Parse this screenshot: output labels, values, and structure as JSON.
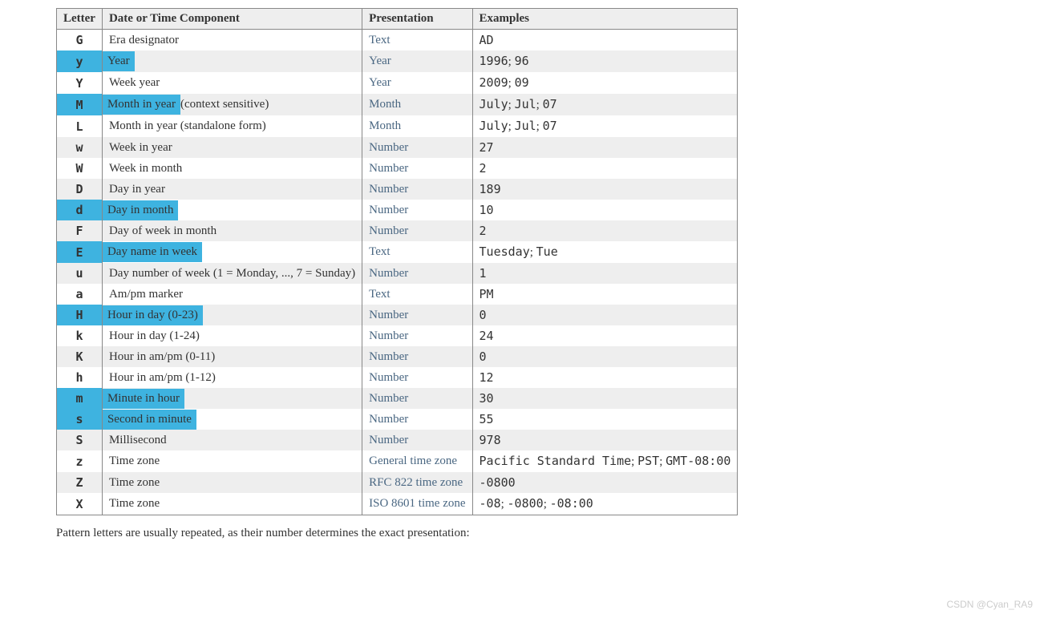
{
  "headers": [
    "Letter",
    "Date or Time Component",
    "Presentation",
    "Examples"
  ],
  "rows": [
    {
      "letter": "G",
      "desc_hl": "",
      "desc_rest": "Era designator",
      "presentation": "Text",
      "examples": [
        {
          "t": "code",
          "v": "AD"
        }
      ],
      "highlight": false
    },
    {
      "letter": "y",
      "desc_hl": "Year",
      "desc_rest": "",
      "presentation": "Year",
      "examples": [
        {
          "t": "code",
          "v": "1996"
        },
        {
          "t": "plain",
          "v": "; "
        },
        {
          "t": "code",
          "v": "96"
        }
      ],
      "highlight": true
    },
    {
      "letter": "Y",
      "desc_hl": "",
      "desc_rest": "Week year",
      "presentation": "Year",
      "examples": [
        {
          "t": "code",
          "v": "2009"
        },
        {
          "t": "plain",
          "v": "; "
        },
        {
          "t": "code",
          "v": "09"
        }
      ],
      "highlight": false
    },
    {
      "letter": "M",
      "desc_hl": "Month in year ",
      "desc_rest": "(context sensitive)",
      "presentation": "Month",
      "examples": [
        {
          "t": "code",
          "v": "July"
        },
        {
          "t": "plain",
          "v": "; "
        },
        {
          "t": "code",
          "v": "Jul"
        },
        {
          "t": "plain",
          "v": "; "
        },
        {
          "t": "code",
          "v": "07"
        }
      ],
      "highlight": true
    },
    {
      "letter": "L",
      "desc_hl": "",
      "desc_rest": "Month in year (standalone form)",
      "presentation": "Month",
      "examples": [
        {
          "t": "code",
          "v": "July"
        },
        {
          "t": "plain",
          "v": "; "
        },
        {
          "t": "code",
          "v": "Jul"
        },
        {
          "t": "plain",
          "v": "; "
        },
        {
          "t": "code",
          "v": "07"
        }
      ],
      "highlight": false
    },
    {
      "letter": "w",
      "desc_hl": "",
      "desc_rest": "Week in year",
      "presentation": "Number",
      "examples": [
        {
          "t": "code",
          "v": "27"
        }
      ],
      "highlight": false
    },
    {
      "letter": "W",
      "desc_hl": "",
      "desc_rest": "Week in month",
      "presentation": "Number",
      "examples": [
        {
          "t": "code",
          "v": "2"
        }
      ],
      "highlight": false
    },
    {
      "letter": "D",
      "desc_hl": "",
      "desc_rest": "Day in year",
      "presentation": "Number",
      "examples": [
        {
          "t": "code",
          "v": "189"
        }
      ],
      "highlight": false
    },
    {
      "letter": "d",
      "desc_hl": "Day in month",
      "desc_rest": "",
      "presentation": "Number",
      "examples": [
        {
          "t": "code",
          "v": "10"
        }
      ],
      "highlight": true
    },
    {
      "letter": "F",
      "desc_hl": "",
      "desc_rest": "Day of week in month",
      "presentation": "Number",
      "examples": [
        {
          "t": "code",
          "v": "2"
        }
      ],
      "highlight": false
    },
    {
      "letter": "E",
      "desc_hl": "Day name in week",
      "desc_rest": "",
      "presentation": "Text",
      "examples": [
        {
          "t": "code",
          "v": "Tuesday"
        },
        {
          "t": "plain",
          "v": "; "
        },
        {
          "t": "code",
          "v": "Tue"
        }
      ],
      "highlight": true
    },
    {
      "letter": "u",
      "desc_hl": "",
      "desc_rest": "Day number of week (1 = Monday, ..., 7 = Sunday)",
      "presentation": "Number",
      "examples": [
        {
          "t": "code",
          "v": "1"
        }
      ],
      "highlight": false
    },
    {
      "letter": "a",
      "desc_hl": "",
      "desc_rest": "Am/pm marker",
      "presentation": "Text",
      "examples": [
        {
          "t": "code",
          "v": "PM"
        }
      ],
      "highlight": false
    },
    {
      "letter": "H",
      "desc_hl": "Hour in day (0-23)",
      "desc_rest": "",
      "presentation": "Number",
      "examples": [
        {
          "t": "code",
          "v": "0"
        }
      ],
      "highlight": true
    },
    {
      "letter": "k",
      "desc_hl": "",
      "desc_rest": "Hour in day (1-24)",
      "presentation": "Number",
      "examples": [
        {
          "t": "code",
          "v": "24"
        }
      ],
      "highlight": false
    },
    {
      "letter": "K",
      "desc_hl": "",
      "desc_rest": "Hour in am/pm (0-11)",
      "presentation": "Number",
      "examples": [
        {
          "t": "code",
          "v": "0"
        }
      ],
      "highlight": false
    },
    {
      "letter": "h",
      "desc_hl": "",
      "desc_rest": "Hour in am/pm (1-12)",
      "presentation": "Number",
      "examples": [
        {
          "t": "code",
          "v": "12"
        }
      ],
      "highlight": false
    },
    {
      "letter": "m",
      "desc_hl": "Minute in hour",
      "desc_rest": "",
      "presentation": "Number",
      "examples": [
        {
          "t": "code",
          "v": "30"
        }
      ],
      "highlight": true
    },
    {
      "letter": "s",
      "desc_hl": "Second in minute",
      "desc_rest": "",
      "presentation": "Number",
      "examples": [
        {
          "t": "code",
          "v": "55"
        }
      ],
      "highlight": true
    },
    {
      "letter": "S",
      "desc_hl": "",
      "desc_rest": "Millisecond",
      "presentation": "Number",
      "examples": [
        {
          "t": "code",
          "v": "978"
        }
      ],
      "highlight": false
    },
    {
      "letter": "z",
      "desc_hl": "",
      "desc_rest": "Time zone",
      "presentation": "General time zone",
      "examples": [
        {
          "t": "code",
          "v": "Pacific Standard Time"
        },
        {
          "t": "plain",
          "v": "; "
        },
        {
          "t": "code",
          "v": "PST"
        },
        {
          "t": "plain",
          "v": "; "
        },
        {
          "t": "code",
          "v": "GMT-08:00"
        }
      ],
      "highlight": false
    },
    {
      "letter": "Z",
      "desc_hl": "",
      "desc_rest": "Time zone",
      "presentation": "RFC 822 time zone",
      "examples": [
        {
          "t": "code",
          "v": "-0800"
        }
      ],
      "highlight": false
    },
    {
      "letter": "X",
      "desc_hl": "",
      "desc_rest": "Time zone",
      "presentation": "ISO 8601 time zone",
      "examples": [
        {
          "t": "code",
          "v": "-08"
        },
        {
          "t": "plain",
          "v": "; "
        },
        {
          "t": "code",
          "v": "-0800"
        },
        {
          "t": "plain",
          "v": "; "
        },
        {
          "t": "code",
          "v": "-08:00"
        }
      ],
      "highlight": false
    }
  ],
  "footnote": "Pattern letters are usually repeated, as their number determines the exact presentation:",
  "watermark": "CSDN @Cyan_RA9"
}
